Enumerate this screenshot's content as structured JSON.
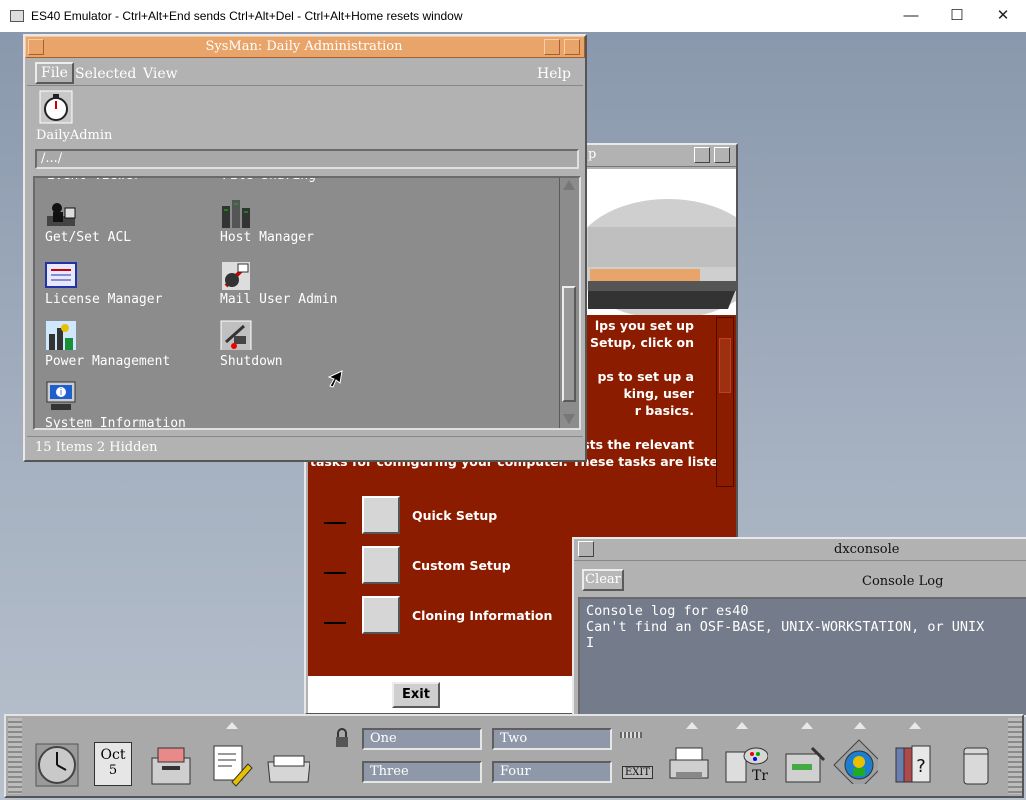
{
  "host": {
    "title": "ES40 Emulator - Ctrl+Alt+End sends Ctrl+Alt+Del - Ctrl+Alt+Home resets window",
    "minimize": "—",
    "maximize": "☐",
    "close": "✕"
  },
  "sysman": {
    "title": "SysMan: Daily Administration",
    "menu": {
      "file": "File",
      "selected": "Selected",
      "view": "View",
      "help": "Help"
    },
    "toolbar_label": "DailyAdmin",
    "path": "/.../",
    "items": [
      {
        "label": "Get/Set ACL",
        "icon": "acl-icon"
      },
      {
        "label": "Host Manager",
        "icon": "host-manager-icon"
      },
      {
        "label": "License Manager",
        "icon": "license-icon"
      },
      {
        "label": "Mail User Admin",
        "icon": "mail-icon"
      },
      {
        "label": "Power Management",
        "icon": "power-icon"
      },
      {
        "label": "Shutdown",
        "icon": "shutdown-icon"
      },
      {
        "label": "System Information",
        "icon": "system-info-icon"
      }
    ],
    "status": "15 Items 2 Hidden"
  },
  "setup": {
    "title_fragment": "p",
    "text_lines": [
      "lps you set up",
      "n Setup, click on",
      "",
      "ps to set up a",
      "king, user",
      "r basics.",
      "",
      "ists the relevant",
      "tasks for configuring your computer. These tasks are listed"
    ],
    "rows": [
      {
        "label": "Quick Setup"
      },
      {
        "label": "Custom Setup"
      },
      {
        "label": "Cloning Information"
      }
    ],
    "exit": "Exit"
  },
  "console": {
    "title": "dxconsole",
    "clear": "Clear",
    "header": "Console Log",
    "lines": [
      "Console log for es40",
      "Can't find an OSF-BASE, UNIX-WORKSTATION, or UNIX"
    ]
  },
  "panel": {
    "calendar_month": "Oct",
    "calendar_day": "5",
    "workspaces": [
      "One",
      "Two",
      "Three",
      "Four"
    ],
    "exit_label": "EXIT"
  },
  "colors": {
    "accent": "#e9a469",
    "setup_red": "#8b1c00",
    "console_bg": "#747b8a"
  }
}
